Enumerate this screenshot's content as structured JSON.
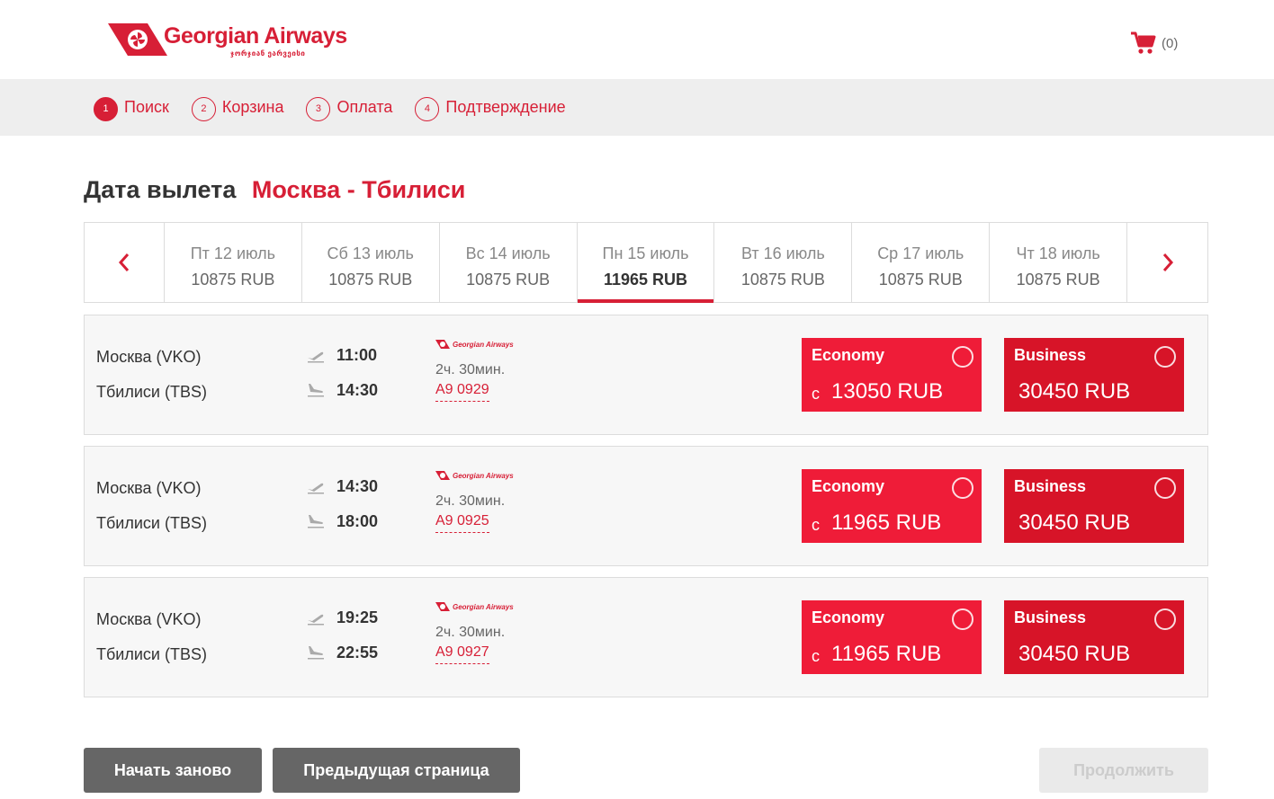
{
  "brand": {
    "name": "Georgian Airways",
    "subtitle": "ჯორჯიან ეარვეისი",
    "primary_color": "#d71f36"
  },
  "cart": {
    "icon": "cart-icon",
    "count": "(0)"
  },
  "steps": [
    {
      "num": "1",
      "label": "Поиск",
      "active": true
    },
    {
      "num": "2",
      "label": "Корзина",
      "active": false
    },
    {
      "num": "3",
      "label": "Оплата",
      "active": false
    },
    {
      "num": "4",
      "label": "Подтверждение",
      "active": false
    }
  ],
  "title": {
    "main": "Дата вылета",
    "route": "Москва - Тбилиси"
  },
  "dates": [
    {
      "day": "Пт 12 июль",
      "price": "10875 RUB",
      "selected": false
    },
    {
      "day": "Сб 13 июль",
      "price": "10875 RUB",
      "selected": false
    },
    {
      "day": "Вс 14 июль",
      "price": "10875 RUB",
      "selected": false
    },
    {
      "day": "Пн 15 июль",
      "price": "11965 RUB",
      "selected": true
    },
    {
      "day": "Вт 16 июль",
      "price": "10875 RUB",
      "selected": false
    },
    {
      "day": "Ср 17 июль",
      "price": "10875 RUB",
      "selected": false
    },
    {
      "day": "Чт 18 июль",
      "price": "10875 RUB",
      "selected": false
    }
  ],
  "flights": [
    {
      "from": "Москва (VKO)",
      "to": "Тбилиси (TBS)",
      "dep_time": "11:00",
      "arr_time": "14:30",
      "airline": "Georgian Airways",
      "duration": "2ч. 30мин.",
      "flight_no": "A9 0929",
      "economy": {
        "label": "Economy",
        "prefix": "с",
        "price": "13050 RUB"
      },
      "business": {
        "label": "Business",
        "price": "30450 RUB"
      }
    },
    {
      "from": "Москва (VKO)",
      "to": "Тбилиси (TBS)",
      "dep_time": "14:30",
      "arr_time": "18:00",
      "airline": "Georgian Airways",
      "duration": "2ч. 30мин.",
      "flight_no": "A9 0925",
      "economy": {
        "label": "Economy",
        "prefix": "с",
        "price": "11965 RUB"
      },
      "business": {
        "label": "Business",
        "price": "30450 RUB"
      }
    },
    {
      "from": "Москва (VKO)",
      "to": "Тбилиси (TBS)",
      "dep_time": "19:25",
      "arr_time": "22:55",
      "airline": "Georgian Airways",
      "duration": "2ч. 30мин.",
      "flight_no": "A9 0927",
      "economy": {
        "label": "Economy",
        "prefix": "с",
        "price": "11965 RUB"
      },
      "business": {
        "label": "Business",
        "price": "30450 RUB"
      }
    }
  ],
  "buttons": {
    "restart": "Начать заново",
    "previous": "Предыдущая страница",
    "continue": "Продолжить"
  }
}
